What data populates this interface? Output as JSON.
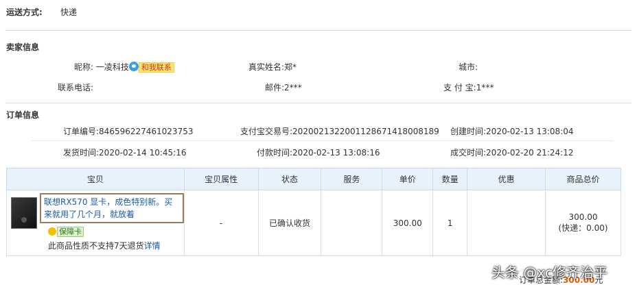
{
  "shipping": {
    "label": "运送方式:",
    "value": "快递"
  },
  "seller": {
    "heading": "卖家信息",
    "nickname_label": "昵称:",
    "nickname": "一凌科技",
    "contact_label": "和我联系",
    "realname_label": "真实姓名:",
    "realname": "郑*",
    "city_label": "城市:",
    "city": "",
    "phone_label": "联系电话:",
    "phone": "",
    "email_label": "邮件:",
    "email": "2***",
    "alipay_label": "支 付 宝:",
    "alipay": "1***"
  },
  "order": {
    "heading": "订单信息",
    "order_no_label": "订单编号:",
    "order_no": "846596227461023753",
    "alipay_trade_label": "支付宝交易号:",
    "alipay_trade": "2020021322001128671418008189",
    "created_label": "创建时间:",
    "created": "2020-02-13 13:08:04",
    "shipped_label": "发货时间:",
    "shipped": "2020-02-14 10:45:16",
    "paid_label": "付款时间:",
    "paid": "2020-02-13 13:08:16",
    "completed_label": "成交时间:",
    "completed": "2020-02-20 21:24:12"
  },
  "table": {
    "headers": [
      "宝贝",
      "宝贝属性",
      "状态",
      "服务",
      "单价",
      "数量",
      "优惠",
      "商品总价"
    ],
    "row": {
      "title": "联想RX570 显卡，成色特别新。买来就用了几个月，就放着",
      "guarantee": "保障卡",
      "no_return": "此商品性质不支持7天退货",
      "detail_link": "详情",
      "attributes": "-",
      "status": "已确认收货",
      "service": "",
      "unit_price": "300.00",
      "quantity": "1",
      "discount": "",
      "total": "300.00",
      "shipping_fee": "(快递：0.00)"
    }
  },
  "footer": {
    "total_label": "订单总金额:",
    "total_amount": "300.00",
    "unit": "元",
    "watermark": "头条 @xc修齐治平"
  }
}
